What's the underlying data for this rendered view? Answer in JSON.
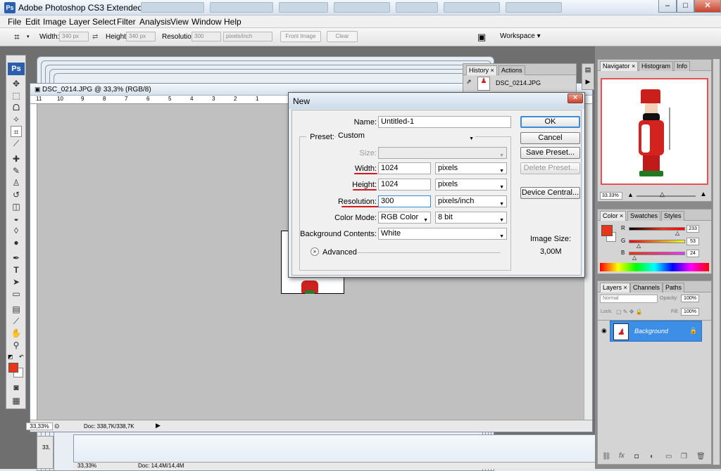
{
  "app": {
    "title": "Adobe Photoshop CS3 Extended",
    "logo": "Ps"
  },
  "window_controls": {
    "minimize": "–",
    "maximize": "□",
    "close": "✕"
  },
  "menu": [
    "File",
    "Edit",
    "Image",
    "Layer",
    "Select",
    "Filter",
    "Analysis",
    "View",
    "Window",
    "Help"
  ],
  "options": {
    "width_label": "Width:",
    "width_value": "340 px",
    "height_label": "Height:",
    "height_value": "340 px",
    "resolution_label": "Resolution:",
    "resolution_value": "300",
    "resolution_unit": "pixels/inch",
    "front_image": "Front Image",
    "clear": "Clear",
    "workspace": "Workspace ▾"
  },
  "document": {
    "title": "DSC_0214.JPG @ 33,3% (RGB/8)",
    "zoom": "33,33%",
    "doc_info": "Doc: 338,7K/338,7K",
    "ruler_ticks": [
      "11",
      "10",
      "9",
      "8",
      "7",
      "6",
      "5",
      "4",
      "3",
      "2",
      "1"
    ]
  },
  "stack": {
    "zoom1": "33,",
    "zoom2": "33,33%",
    "doc2": "Doc: 14,4M/14,4M"
  },
  "history_panel": {
    "tabs": [
      "History",
      "Actions"
    ],
    "snapshot": "DSC_0214.JPG"
  },
  "dialog": {
    "title": "New",
    "name_label": "Name:",
    "name_value": "Untitled-1",
    "preset_label": "Preset:",
    "preset_value": "Custom",
    "size_label": "Size:",
    "size_value": "",
    "width_label": "Width:",
    "width_value": "1024",
    "width_unit": "pixels",
    "height_label": "Height:",
    "height_value": "1024",
    "height_unit": "pixels",
    "resolution_label": "Resolution:",
    "resolution_value": "300",
    "resolution_unit": "pixels/inch",
    "color_mode_label": "Color Mode:",
    "color_mode_value": "RGB Color",
    "bit_depth": "8 bit",
    "bg_label": "Background Contents:",
    "bg_value": "White",
    "advanced_label": "Advanced",
    "ok": "OK",
    "cancel": "Cancel",
    "save_preset": "Save Preset...",
    "delete_preset": "Delete Preset...",
    "device_central": "Device Central...",
    "image_size_label": "Image Size:",
    "image_size_value": "3,00M"
  },
  "navigator": {
    "tabs": [
      "Navigator",
      "Histogram",
      "Info"
    ],
    "zoom": "33.33%"
  },
  "color_panel": {
    "tabs": [
      "Color",
      "Swatches",
      "Styles"
    ],
    "r_label": "R",
    "g_label": "G",
    "b_label": "B",
    "r": "233",
    "g": "53",
    "b": "24",
    "swatch": "#e93518"
  },
  "layers_panel": {
    "tabs": [
      "Layers",
      "Channels",
      "Paths"
    ],
    "blend": "Normal",
    "opacity_label": "Opacity:",
    "opacity": "100%",
    "lock_label": "Lock:",
    "fill_label": "Fill:",
    "fill": "100%",
    "layer_name": "Background"
  },
  "colors": {
    "accent": "#3d8ee7",
    "foreground": "#e93518",
    "red_underline": "#d21a1a"
  }
}
